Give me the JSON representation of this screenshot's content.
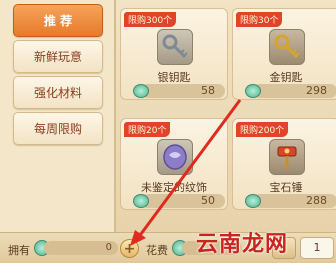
{
  "sidebar": {
    "tabs": [
      {
        "label": "推 荐"
      },
      {
        "label": "新鲜玩意"
      },
      {
        "label": "强化材料"
      },
      {
        "label": "每周限购"
      }
    ]
  },
  "cards": [
    {
      "badge": "限购300个",
      "name": "银钥匙",
      "price": "58"
    },
    {
      "badge": "限购30个",
      "name": "金钥匙",
      "price": "298"
    },
    {
      "badge": "限购20个",
      "name": "未鉴定的纹饰",
      "price": "50"
    },
    {
      "badge": "限购200个",
      "name": "宝石锤",
      "price": "288"
    }
  ],
  "bottom": {
    "own_label": "拥有",
    "own_value": "0",
    "spend_label": "花费",
    "spend_value": "0",
    "plus": "+",
    "quantity": "1"
  },
  "watermark": "云南龙网",
  "colors": {
    "active_tab": "#e67a2a",
    "badge": "#e0442a",
    "arrow": "#e02a1f",
    "watermark": "#c8251e"
  },
  "icons": [
    "silver-key-icon",
    "gold-key-icon",
    "emblem-icon",
    "gem-hammer-icon",
    "jade-coin-icon",
    "plus-icon"
  ]
}
